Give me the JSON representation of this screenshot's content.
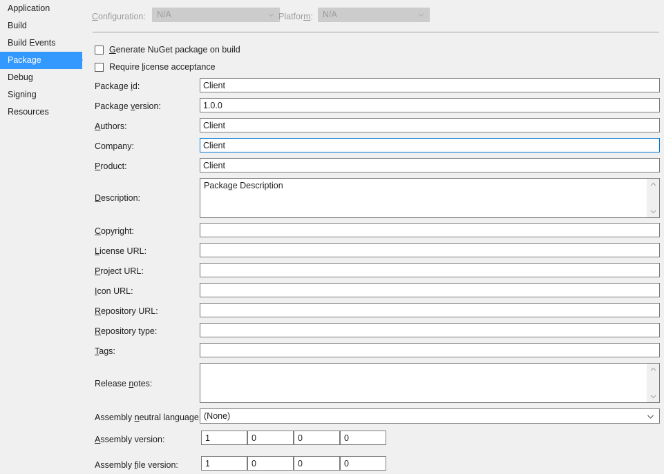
{
  "sidebar": {
    "items": [
      {
        "label": "Application",
        "selected": false
      },
      {
        "label": "Build",
        "selected": false
      },
      {
        "label": "Build Events",
        "selected": false
      },
      {
        "label": "Package",
        "selected": true
      },
      {
        "label": "Debug",
        "selected": false
      },
      {
        "label": "Signing",
        "selected": false
      },
      {
        "label": "Resources",
        "selected": false
      }
    ]
  },
  "header": {
    "configuration_label": "Configuration:",
    "configuration_value": "N/A",
    "platform_label": "Platform:",
    "platform_value": "N/A"
  },
  "checkboxes": [
    {
      "label": "Generate NuGet package on build",
      "checked": false
    },
    {
      "label": "Require license acceptance",
      "checked": false
    }
  ],
  "fields": {
    "package_id": {
      "label": "Package id:",
      "value": "Client"
    },
    "package_version": {
      "label": "Package version:",
      "value": "1.0.0"
    },
    "authors": {
      "label": "Authors:",
      "value": "Client"
    },
    "company": {
      "label": "Company:",
      "value": "Client",
      "focused": true
    },
    "product": {
      "label": "Product:",
      "value": "Client"
    },
    "description": {
      "label": "Description:",
      "value": "Package Description"
    },
    "copyright": {
      "label": "Copyright:",
      "value": ""
    },
    "license_url": {
      "label": "License URL:",
      "value": ""
    },
    "project_url": {
      "label": "Project URL:",
      "value": ""
    },
    "icon_url": {
      "label": "Icon URL:",
      "value": ""
    },
    "repository_url": {
      "label": "Repository URL:",
      "value": ""
    },
    "repository_type": {
      "label": "Repository type:",
      "value": ""
    },
    "tags": {
      "label": "Tags:",
      "value": ""
    },
    "release_notes": {
      "label": "Release notes:",
      "value": ""
    },
    "assembly_neutral_language": {
      "label": "Assembly neutral language:",
      "value": "(None)"
    },
    "assembly_version": {
      "label": "Assembly version:",
      "parts": [
        "1",
        "0",
        "0",
        "0"
      ]
    },
    "assembly_file_version": {
      "label": "Assembly file version:",
      "parts": [
        "1",
        "0",
        "0",
        "0"
      ]
    }
  },
  "colors": {
    "accent": "#3399ff",
    "focus_border": "#0078d7",
    "background": "#f0f0f0",
    "field_border": "#7a7a7a",
    "disabled_text": "#9b9b9b"
  },
  "icons": {
    "chevron_down": "chevron-down-icon",
    "scroll_up": "scroll-up-arrow-icon",
    "scroll_down": "scroll-down-arrow-icon",
    "selection_arrow": "selection-arrow-icon"
  }
}
